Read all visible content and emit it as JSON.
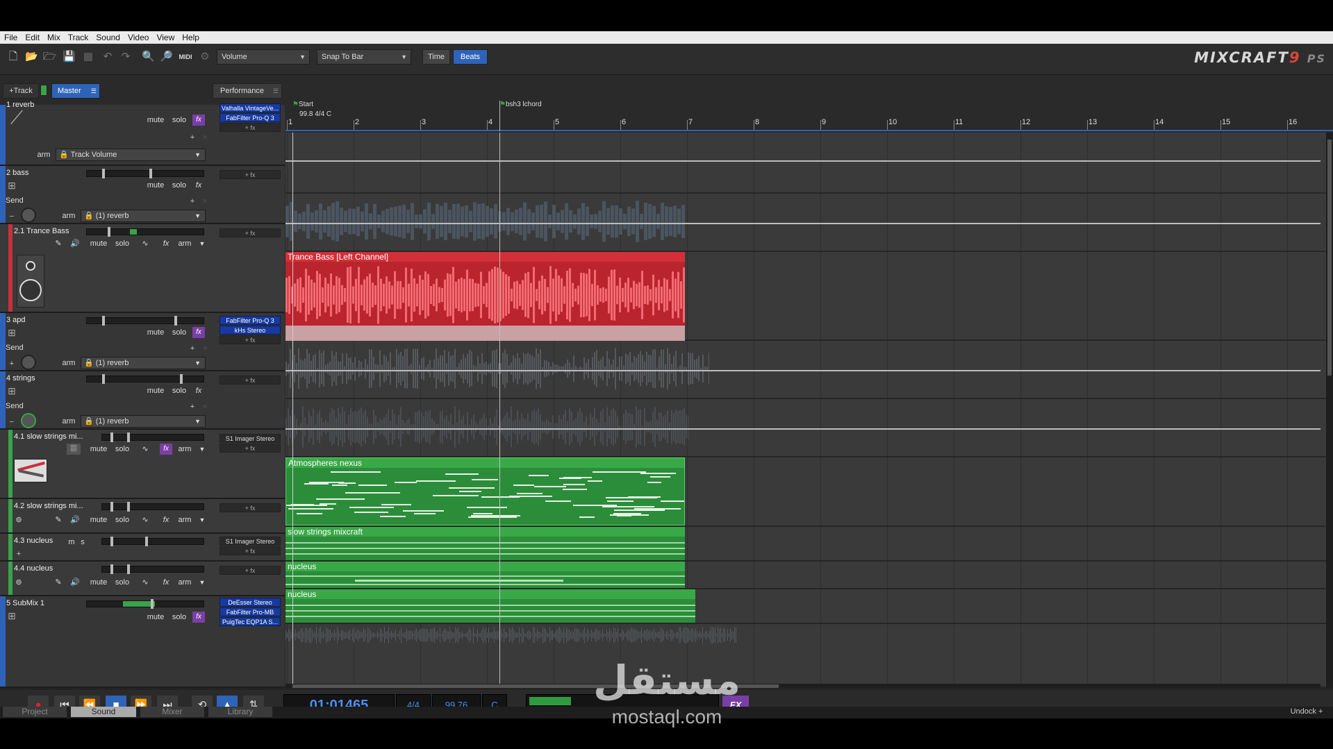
{
  "menu": [
    "File",
    "Edit",
    "Mix",
    "Track",
    "Sound",
    "Video",
    "View",
    "Help"
  ],
  "toolbar": {
    "icons": [
      "new-file-icon",
      "open-folder-icon",
      "open-project-icon",
      "save-icon",
      "grid-icon",
      "undo-icon",
      "redo-icon",
      "zoom-in-icon",
      "zoom-out-icon",
      "midi-icon",
      "settings-icon"
    ],
    "midi_label": "MIDI",
    "automation_select": "Volume",
    "snap_select": "Snap To Bar",
    "time_label": "Time",
    "beats_label": "Beats",
    "logo_main": "MIXCRAFT",
    "logo_ver": "9",
    "logo_suffix": "PS"
  },
  "header": {
    "add_track": "+Track",
    "master": "Master",
    "performance": "Performance"
  },
  "ruler": {
    "bars": [
      "1",
      "2",
      "3",
      "4",
      "5",
      "6",
      "7",
      "8",
      "9",
      "10",
      "11",
      "12",
      "13",
      "14",
      "15",
      "16"
    ],
    "marker_start": "Start",
    "marker_start_info": "99.8 4/4 C",
    "marker_chord": "bsh3 lchord"
  },
  "common": {
    "mute": "mute",
    "solo": "solo",
    "fx": "fx",
    "arm": "arm",
    "add_fx": "+ fx",
    "send": "Send",
    "m": "m",
    "s": "s"
  },
  "tracks": [
    {
      "name": "1 reverb",
      "plugins": [
        "Valhalla VintageVe...",
        "FabFilter Pro-Q 3"
      ],
      "automation": "Track Volume",
      "color": "#2e63b8"
    },
    {
      "name": "2 bass",
      "plugins": [],
      "automation": "(1) reverb",
      "color": "#2e63b8"
    },
    {
      "name": "2.1 Trance Bass",
      "plugins": [],
      "color": "#c8303a",
      "clip": "Trance Bass [Left Channel]"
    },
    {
      "name": "3 apd",
      "plugins": [
        "FabFilter Pro-Q 3",
        "kHs Stereo"
      ],
      "automation": "(1) reverb",
      "color": "#2e63b8"
    },
    {
      "name": "4 strings",
      "plugins": [],
      "automation": "(1) reverb",
      "color": "#2e63b8"
    },
    {
      "name": "4.1 slow strings mi...",
      "plugins": [
        "S1 Imager Stereo"
      ],
      "color": "#3aa24a",
      "clip": "Atmospheres nexus"
    },
    {
      "name": "4.2 slow strings mi...",
      "plugins": [],
      "color": "#3aa24a",
      "clip": "slow strings mixcraft"
    },
    {
      "name": "4.3 nucleus",
      "plugins": [
        "S1 Imager Stereo"
      ],
      "color": "#3aa24a",
      "clip": "nucleus"
    },
    {
      "name": "4.4 nucleus",
      "plugins": [],
      "color": "#3aa24a",
      "clip": "nucleus"
    },
    {
      "name": "5 SubMix 1",
      "plugins": [
        "DeEsser Stereo",
        "FabFilter Pro-MB",
        "PuigTec EQP1A S..."
      ],
      "color": "#2e63b8"
    }
  ],
  "transport": {
    "time": "01:01465",
    "signature": "4/4",
    "tempo": "99.76",
    "key": "C",
    "fx": "FX",
    "buttons": [
      "record-icon",
      "skip-start-icon",
      "rewind-icon",
      "stop-icon",
      "fast-forward-icon",
      "skip-end-icon",
      "loop-icon",
      "metronome-icon",
      "punch-icon"
    ]
  },
  "bottom_tabs": [
    "Project",
    "Sound",
    "Mixer",
    "Library"
  ],
  "undock": "Undock",
  "watermark": {
    "arabic": "مستقل",
    "site": "mostaql.com"
  },
  "colors": {
    "accent": "#2e63b8",
    "red_clip": "#e7454e",
    "green_clip": "#2f9a3e",
    "fx_purple": "#7a3fa6"
  }
}
